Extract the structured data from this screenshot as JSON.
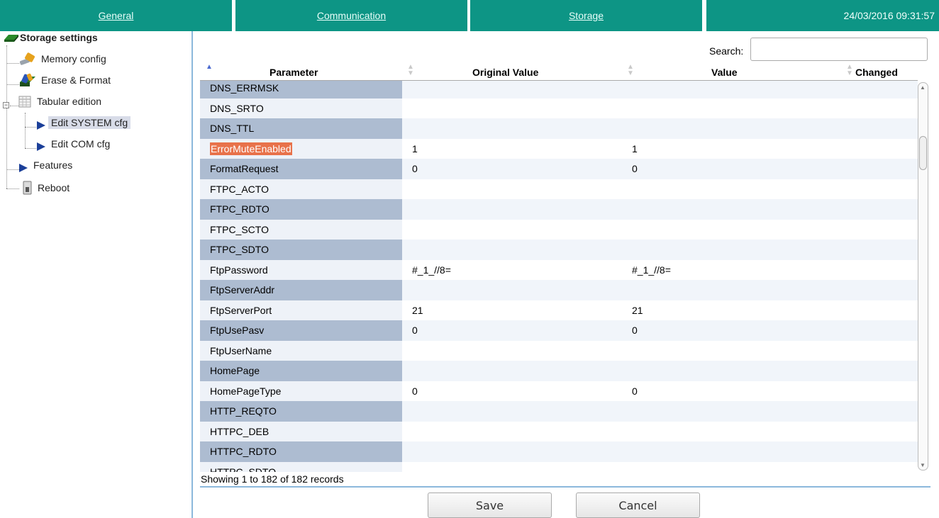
{
  "nav": {
    "general": "General",
    "communication": "Communication",
    "storage": "Storage",
    "datetime": "24/03/2016 09:31:57"
  },
  "sidebar": {
    "root_label": "Storage settings",
    "items": [
      {
        "label": "Memory config",
        "icon": "wrench-icon"
      },
      {
        "label": "Erase & Format",
        "icon": "erase-format-icon"
      },
      {
        "label": "Tabular edition",
        "icon": "table-icon"
      },
      {
        "label": "Edit SYSTEM cfg",
        "icon": "triangle-right-icon",
        "selected": true
      },
      {
        "label": "Edit COM cfg",
        "icon": "triangle-right-icon"
      },
      {
        "label": "Features",
        "icon": "triangle-right-icon"
      },
      {
        "label": "Reboot",
        "icon": "power-switch-icon"
      }
    ]
  },
  "table": {
    "search_label": "Search:",
    "search_value": "",
    "headers": {
      "parameter": "Parameter",
      "original": "Original Value",
      "value": "Value",
      "changed": "Changed"
    },
    "rows": [
      {
        "param": "DNS_ERRMSK",
        "original": "",
        "value": "",
        "changed": ""
      },
      {
        "param": "DNS_SRTO",
        "original": "",
        "value": "",
        "changed": ""
      },
      {
        "param": "DNS_TTL",
        "original": "",
        "value": "",
        "changed": ""
      },
      {
        "param": "ErrorMuteEnabled",
        "original": "1",
        "value": "1",
        "changed": "",
        "highlight": true
      },
      {
        "param": "FormatRequest",
        "original": "0",
        "value": "0",
        "changed": ""
      },
      {
        "param": "FTPC_ACTO",
        "original": "",
        "value": "",
        "changed": ""
      },
      {
        "param": "FTPC_RDTO",
        "original": "",
        "value": "",
        "changed": ""
      },
      {
        "param": "FTPC_SCTO",
        "original": "",
        "value": "",
        "changed": ""
      },
      {
        "param": "FTPC_SDTO",
        "original": "",
        "value": "",
        "changed": ""
      },
      {
        "param": "FtpPassword",
        "original": "#_1_//8=",
        "value": "#_1_//8=",
        "changed": ""
      },
      {
        "param": "FtpServerAddr",
        "original": "",
        "value": "",
        "changed": ""
      },
      {
        "param": "FtpServerPort",
        "original": "21",
        "value": "21",
        "changed": ""
      },
      {
        "param": "FtpUsePasv",
        "original": "0",
        "value": "0",
        "changed": ""
      },
      {
        "param": "FtpUserName",
        "original": "",
        "value": "",
        "changed": ""
      },
      {
        "param": "HomePage",
        "original": "",
        "value": "",
        "changed": ""
      },
      {
        "param": "HomePageType",
        "original": "0",
        "value": "0",
        "changed": ""
      },
      {
        "param": "HTTP_REQTO",
        "original": "",
        "value": "",
        "changed": ""
      },
      {
        "param": "HTTPC_DEB",
        "original": "",
        "value": "",
        "changed": ""
      },
      {
        "param": "HTTPC_RDTO",
        "original": "",
        "value": "",
        "changed": ""
      },
      {
        "param": "HTTPC_SDTO",
        "original": "",
        "value": "",
        "changed": ""
      }
    ],
    "info": "Showing 1 to 182 of 182 records"
  },
  "actions": {
    "save": "Save",
    "cancel": "Cancel"
  },
  "colors": {
    "nav_bg": "#0d9585",
    "highlight": "#e8724a",
    "param_cell_dark": "#adbcd1",
    "divider": "#8cb8dc"
  }
}
